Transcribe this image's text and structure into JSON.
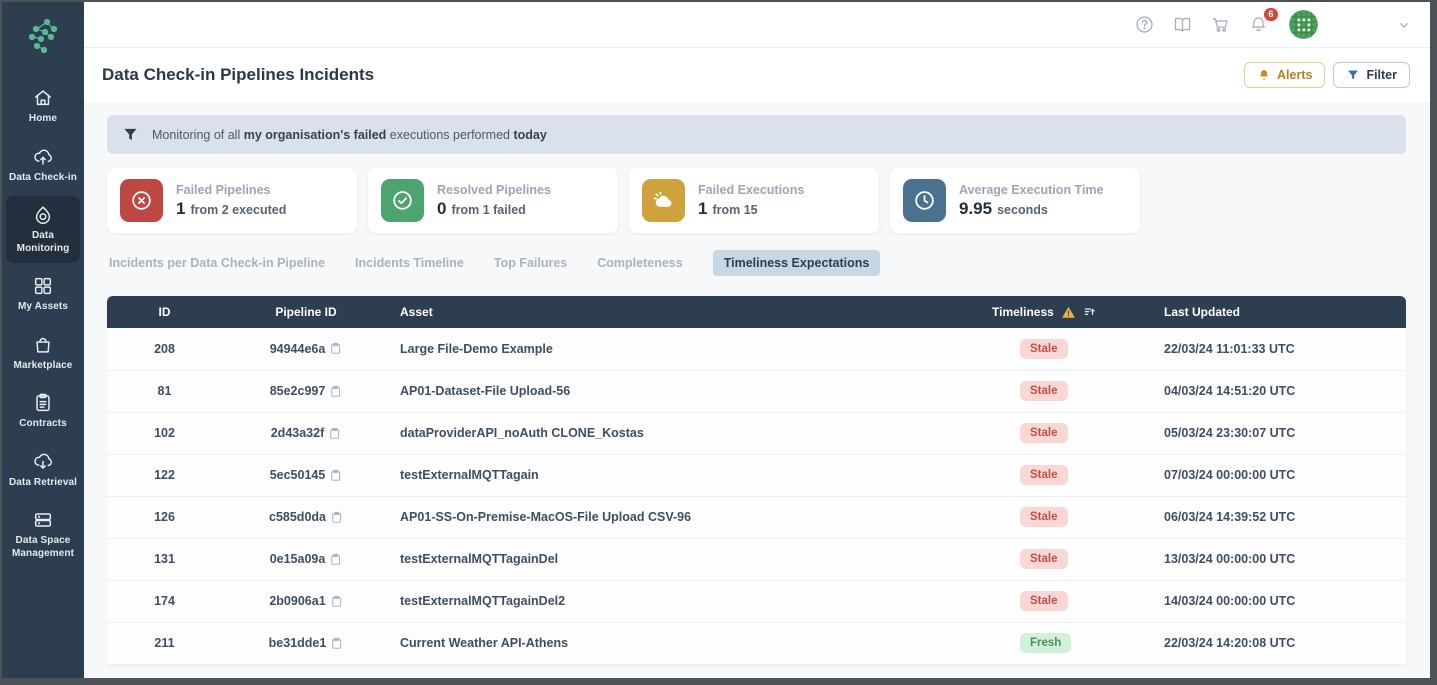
{
  "colors": {
    "sidebar_bg": "#2d3e50",
    "logo_green": "#5cb98f",
    "banner_bg": "#d9e2ec",
    "failed_red": "#bf4743",
    "resolved_green": "#4ea46f",
    "executions_amber": "#d0a23c",
    "time_slate": "#4a7190",
    "stale_text": "#bf4f49",
    "fresh_text": "#42935e",
    "table_header_bg": "#2d3e50"
  },
  "sidebar": {
    "items": [
      {
        "label": "Home",
        "icon": "home-icon"
      },
      {
        "label": "Data Check-in",
        "icon": "cloud-upload-icon"
      },
      {
        "label": "Data Monitoring",
        "icon": "monitoring-icon"
      },
      {
        "label": "My Assets",
        "icon": "grid-icon"
      },
      {
        "label": "Marketplace",
        "icon": "bag-icon"
      },
      {
        "label": "Contracts",
        "icon": "clipboard-icon"
      },
      {
        "label": "Data Retrieval",
        "icon": "cloud-download-icon"
      },
      {
        "label": "Data Space Management",
        "icon": "server-icon"
      }
    ]
  },
  "topbar": {
    "notification_count": "6"
  },
  "page": {
    "title": "Data Check-in Pipelines Incidents",
    "alerts_label": "Alerts",
    "filter_label": "Filter"
  },
  "banner": {
    "prefix": "Monitoring of all ",
    "bold1": "my organisation's failed",
    "middle": " executions performed ",
    "bold2": "today"
  },
  "stats": [
    {
      "label": "Failed Pipelines",
      "value": "1",
      "suffix": "from 2 executed"
    },
    {
      "label": "Resolved Pipelines",
      "value": "0",
      "suffix": "from 1 failed"
    },
    {
      "label": "Failed Executions",
      "value": "1",
      "suffix": "from 15"
    },
    {
      "label": "Average Execution Time",
      "value": "9.95",
      "suffix": "seconds"
    }
  ],
  "tabs": [
    {
      "label": "Incidents per Data Check-in Pipeline"
    },
    {
      "label": "Incidents Timeline"
    },
    {
      "label": "Top Failures"
    },
    {
      "label": "Completeness"
    },
    {
      "label": "Timeliness Expectations"
    }
  ],
  "table": {
    "columns": {
      "id": "ID",
      "pipeline_id": "Pipeline ID",
      "asset": "Asset",
      "timeliness": "Timeliness",
      "last_updated": "Last Updated"
    },
    "rows": [
      {
        "id": "208",
        "pipeline_id": "94944e6a",
        "asset": "Large File-Demo Example",
        "timeliness": "Stale",
        "last_updated": "22/03/24 11:01:33 UTC"
      },
      {
        "id": "81",
        "pipeline_id": "85e2c997",
        "asset": "AP01-Dataset-File Upload-56",
        "timeliness": "Stale",
        "last_updated": "04/03/24 14:51:20 UTC"
      },
      {
        "id": "102",
        "pipeline_id": "2d43a32f",
        "asset": "dataProviderAPI_noAuth CLONE_Kostas",
        "timeliness": "Stale",
        "last_updated": "05/03/24 23:30:07 UTC"
      },
      {
        "id": "122",
        "pipeline_id": "5ec50145",
        "asset": "testExternalMQTTagain",
        "timeliness": "Stale",
        "last_updated": "07/03/24 00:00:00 UTC"
      },
      {
        "id": "126",
        "pipeline_id": "c585d0da",
        "asset": "AP01-SS-On-Premise-MacOS-File Upload CSV-96",
        "timeliness": "Stale",
        "last_updated": "06/03/24 14:39:52 UTC"
      },
      {
        "id": "131",
        "pipeline_id": "0e15a09a",
        "asset": "testExternalMQTTagainDel",
        "timeliness": "Stale",
        "last_updated": "13/03/24 00:00:00 UTC"
      },
      {
        "id": "174",
        "pipeline_id": "2b0906a1",
        "asset": "testExternalMQTTagainDel2",
        "timeliness": "Stale",
        "last_updated": "14/03/24 00:00:00 UTC"
      },
      {
        "id": "211",
        "pipeline_id": "be31dde1",
        "asset": "Current Weather API-Athens",
        "timeliness": "Fresh",
        "last_updated": "22/03/24 14:20:08 UTC"
      }
    ]
  }
}
